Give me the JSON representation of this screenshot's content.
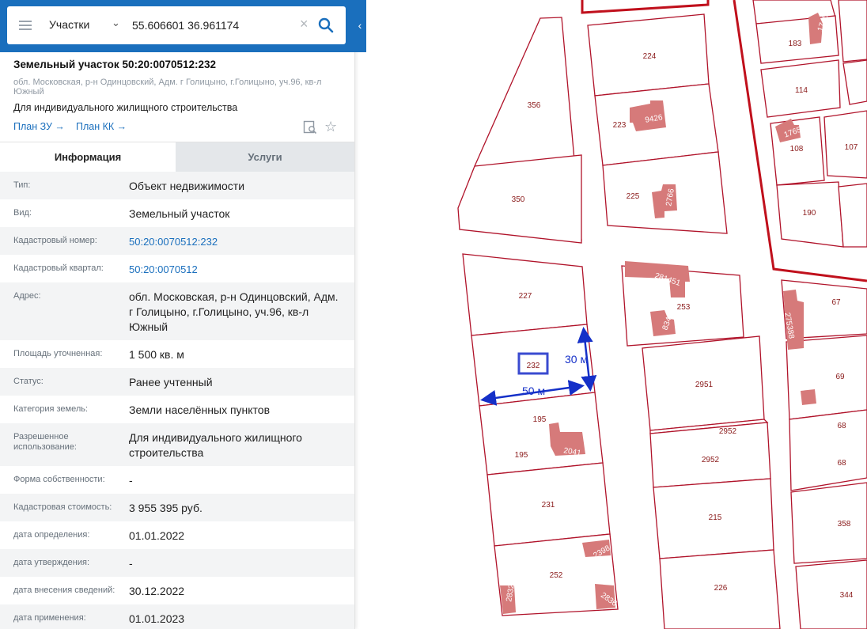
{
  "search": {
    "type_label": "Участки",
    "query": "55.606601 36.961174"
  },
  "object": {
    "title": "Земельный участок 50:20:0070512:232",
    "address": "обл. Московская, р-н Одинцовский, Адм. г Голицыно, г.Голицыно, уч.96, кв-л Южный",
    "purpose": "Для индивидуального жилищного строительства",
    "plan_zu": "План ЗУ →",
    "plan_kk": "План КК →"
  },
  "tabs": {
    "info": "Информация",
    "services": "Услуги"
  },
  "info": {
    "type_label": "Тип:",
    "type_value": "Объект недвижимости",
    "kind_label": "Вид:",
    "kind_value": "Земельный участок",
    "cadnum_label": "Кадастровый номер:",
    "cadnum_value": "50:20:0070512:232",
    "quarter_label": "Кадастровый квартал:",
    "quarter_value": "50:20:0070512",
    "address_label": "Адрес:",
    "address_value": "обл. Московская, р-н Одинцовский, Адм. г Голицыно, г.Голицыно, уч.96, кв-л Южный",
    "area_label": "Площадь уточненная:",
    "area_value": "1 500 кв. м",
    "status_label": "Статус:",
    "status_value": "Ранее учтенный",
    "category_label": "Категория земель:",
    "category_value": "Земли населённых пунктов",
    "use_label": "Разрешенное использование:",
    "use_value": "Для индивидуального жилищного строительства",
    "ownership_label": "Форма собственности:",
    "ownership_value": "-",
    "cost_label": "Кадастровая стоимость:",
    "cost_value": "3 955 395 руб.",
    "date_def_label": "дата определения:",
    "date_def_value": "01.01.2022",
    "date_appr_label": "дата утверждения:",
    "date_appr_value": "-",
    "date_entry_label": "дата внесения сведений:",
    "date_entry_value": "30.12.2022",
    "date_apply_label": "дата применения:",
    "date_apply_value": "01.01.2023"
  },
  "map": {
    "plot_labels": {
      "p224": "224",
      "p223": "223",
      "p225": "225",
      "p356": "356",
      "p350": "350",
      "p227": "227",
      "p232": "232",
      "p195a": "195",
      "p195b": "195",
      "p231": "231",
      "p252": "252",
      "p253": "253",
      "p2951": "2951",
      "p2952a": "2952",
      "p2952b": "2952",
      "p215": "215",
      "p226": "226",
      "p183": "183",
      "p114": "114",
      "p108": "108",
      "p107": "107",
      "p190": "190",
      "p67": "67",
      "p69": "69",
      "p68a": "68",
      "p68b": "68",
      "p358": "358",
      "p344": "344"
    },
    "building_labels": {
      "b9426": "9426",
      "b2766": "2766",
      "b281451": "281451",
      "b834": "834",
      "b2041": "2041",
      "b2398": "2398",
      "b2832": "2832",
      "b2836": "2836",
      "b1765": "1765",
      "b1746": "1746",
      "b275388": "275388"
    },
    "distance_30": "30 м",
    "distance_50": "50 м",
    "colors": {
      "boundary": "#b0132a",
      "building": "#d67a7a",
      "highlight": "#3a4bd0",
      "measure": "#1530c8"
    }
  }
}
